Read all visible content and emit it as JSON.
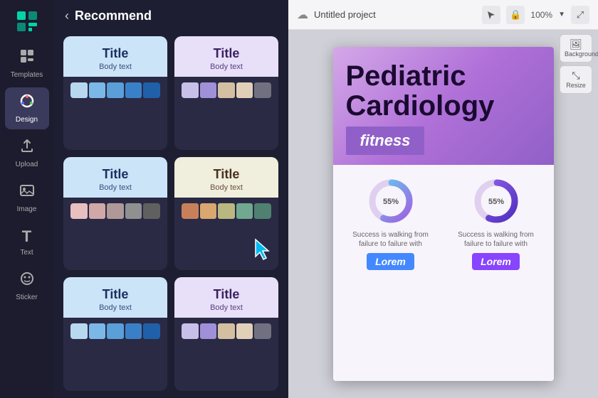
{
  "app": {
    "logo": "⬡",
    "sidebar": {
      "items": [
        {
          "id": "templates",
          "icon": "▦",
          "label": "Templates",
          "active": false
        },
        {
          "id": "design",
          "icon": "◎",
          "label": "Design",
          "active": true
        },
        {
          "id": "upload",
          "icon": "⬆",
          "label": "Upload",
          "active": false
        },
        {
          "id": "image",
          "icon": "🖼",
          "label": "Image",
          "active": false
        },
        {
          "id": "text",
          "icon": "T",
          "label": "Text",
          "active": false
        },
        {
          "id": "sticker",
          "icon": "◯",
          "label": "Sticker",
          "active": false
        }
      ]
    }
  },
  "center_panel": {
    "back_label": "‹",
    "title": "Recommend",
    "cards": [
      {
        "id": "card1",
        "title": "Title",
        "body": "Body text",
        "bg": "light",
        "swatches": [
          "blue1",
          "blue2",
          "blue3",
          "blue4",
          "blue5"
        ]
      },
      {
        "id": "card2",
        "title": "Title",
        "body": "Body text",
        "bg": "light2",
        "swatches": [
          "purp1",
          "purp2",
          "purp3",
          "purp4",
          "purp5"
        ]
      },
      {
        "id": "card3",
        "title": "Title",
        "body": "Body text",
        "bg": "light",
        "swatches": [
          "pk1",
          "pk2",
          "pk3",
          "pk4",
          "pk5"
        ]
      },
      {
        "id": "card4",
        "title": "Title",
        "body": "Body text",
        "bg": "warm",
        "swatches": [
          "wm1",
          "wm2",
          "wm3",
          "wm4",
          "wm5"
        ],
        "has_cursor": true
      },
      {
        "id": "card5",
        "title": "Title",
        "body": "Body text",
        "bg": "light",
        "swatches": [
          "blue1",
          "blue2",
          "blue3",
          "blue4",
          "blue5"
        ]
      },
      {
        "id": "card6",
        "title": "Title",
        "body": "Body text",
        "bg": "light2",
        "swatches": [
          "purp1",
          "purp2",
          "purp3",
          "purp4",
          "purp5"
        ]
      }
    ]
  },
  "right_panel": {
    "project_title": "Untitled project",
    "zoom": "100%",
    "toolbar_buttons": [
      "Background",
      "Resize"
    ],
    "slide": {
      "title_line1": "Pediatric",
      "title_line2": "Cardiology",
      "badge": "fitness",
      "chart1": {
        "label": "55%",
        "description": "Success is walking from failure to failure with"
      },
      "chart2": {
        "label": "55%",
        "description": "Success is walking from failure to failure with"
      },
      "button1": "Lorem",
      "button2": "Lorem"
    }
  }
}
